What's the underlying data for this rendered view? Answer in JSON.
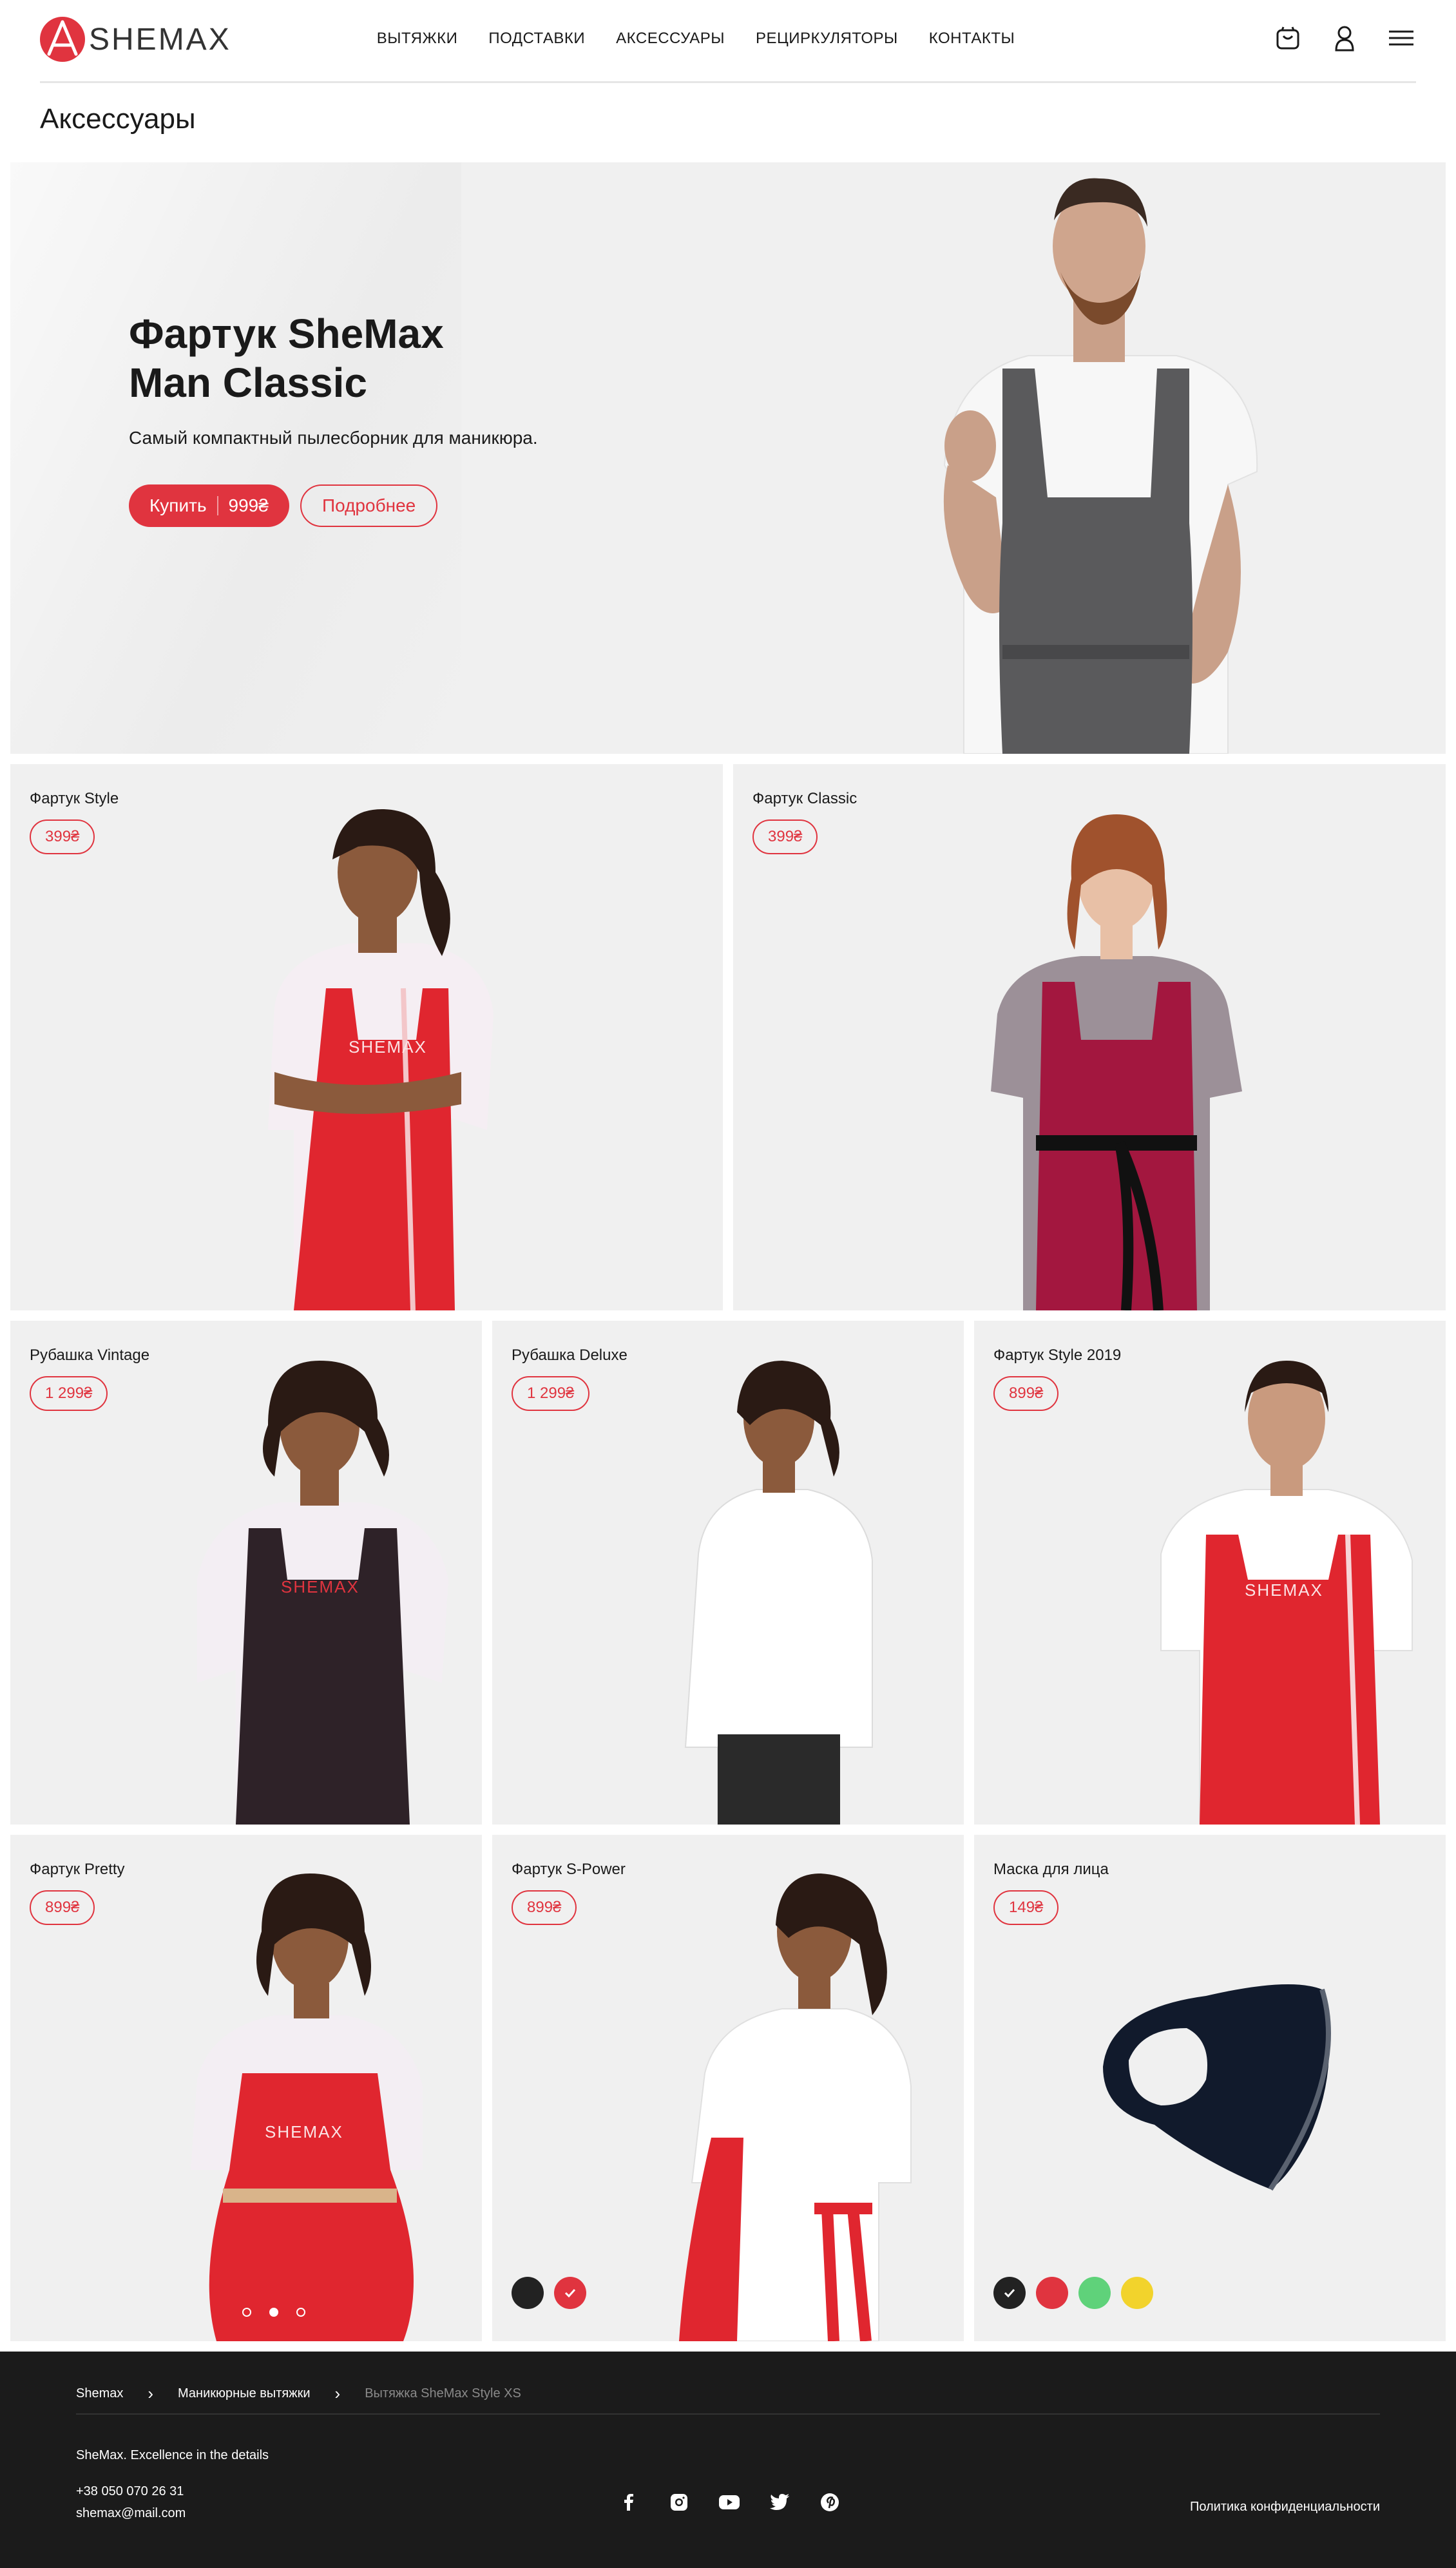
{
  "brand": {
    "name": "SHEMAX",
    "accent": "#e0343f"
  },
  "nav": {
    "items": [
      {
        "label": "ВЫТЯЖКИ"
      },
      {
        "label": "ПОДСТАВКИ"
      },
      {
        "label": "АКСЕССУАРЫ"
      },
      {
        "label": "РЕЦИРКУЛЯТОРЫ"
      },
      {
        "label": "КОНТАКТЫ"
      }
    ],
    "icons": [
      "cart-icon",
      "user-icon",
      "menu-icon"
    ]
  },
  "page": {
    "title": "Аксессуары"
  },
  "hero": {
    "title_line1": "Фартук SheMax",
    "title_line2": "Man Classic",
    "subtitle": "Самый компактный пылесборник для маникюра.",
    "buy_label": "Купить",
    "buy_price": "999₴",
    "more_label": "Подробнее"
  },
  "products": [
    {
      "name": "Фартук Style",
      "price": "399₴",
      "apron_color": "#e0262f"
    },
    {
      "name": "Фартук Classic",
      "price": "399₴",
      "apron_color": "#a3173f"
    },
    {
      "name": "Рубашка Vintage",
      "price": "1 299₴",
      "apron_color": "#2e2228"
    },
    {
      "name": "Рубашка Deluxe",
      "price": "1 299₴",
      "apron_color": "#ffffff"
    },
    {
      "name": "Фартук Style 2019",
      "price": "899₴",
      "apron_color": "#e0262f"
    },
    {
      "name": "Фартук Pretty",
      "price": "899₴",
      "apron_color": "#e0262f"
    },
    {
      "name": "Фартук S-Power",
      "price": "899₴",
      "apron_color": "#e0262f"
    },
    {
      "name": "Маска для лица",
      "price": "149₴",
      "apron_color": "#111a2c"
    }
  ],
  "swatches": {
    "s_power": [
      "#222222",
      "#e0343f"
    ],
    "mask": [
      "#222222",
      "#e0343f",
      "#5fd27a",
      "#f2d32c"
    ]
  },
  "footer": {
    "breadcrumbs": [
      "Shemax",
      "Маникюрные вытяжки",
      "Вытяжка SheMax Style XS"
    ],
    "tagline": "SheMax. Excellence in the details",
    "phone": "+38 050 070 26 31",
    "email": "shemax@mail.com",
    "socials": [
      "facebook-icon",
      "instagram-icon",
      "youtube-icon",
      "twitter-icon",
      "pinterest-icon"
    ],
    "privacy": "Политика конфиденциальности"
  }
}
